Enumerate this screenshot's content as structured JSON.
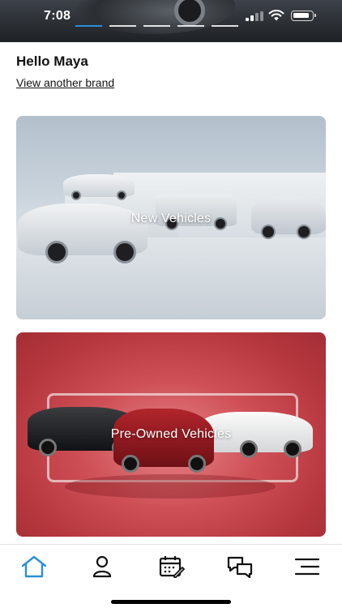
{
  "status_bar": {
    "time": "7:08"
  },
  "colors": {
    "accent": "#2a8fd6",
    "tab_active": "#2a8fd6",
    "tab_inactive": "#111111"
  },
  "greeting": "Hello Maya",
  "brand_link": "View another brand",
  "cards": [
    {
      "label": "New Vehicles"
    },
    {
      "label": "Pre-Owned Vehicles"
    }
  ],
  "tabbar": {
    "items": [
      {
        "icon": "home-icon",
        "active": true
      },
      {
        "icon": "profile-icon",
        "active": false
      },
      {
        "icon": "calendar-edit-icon",
        "active": false
      },
      {
        "icon": "chat-icon",
        "active": false
      },
      {
        "icon": "menu-icon",
        "active": false
      }
    ]
  }
}
